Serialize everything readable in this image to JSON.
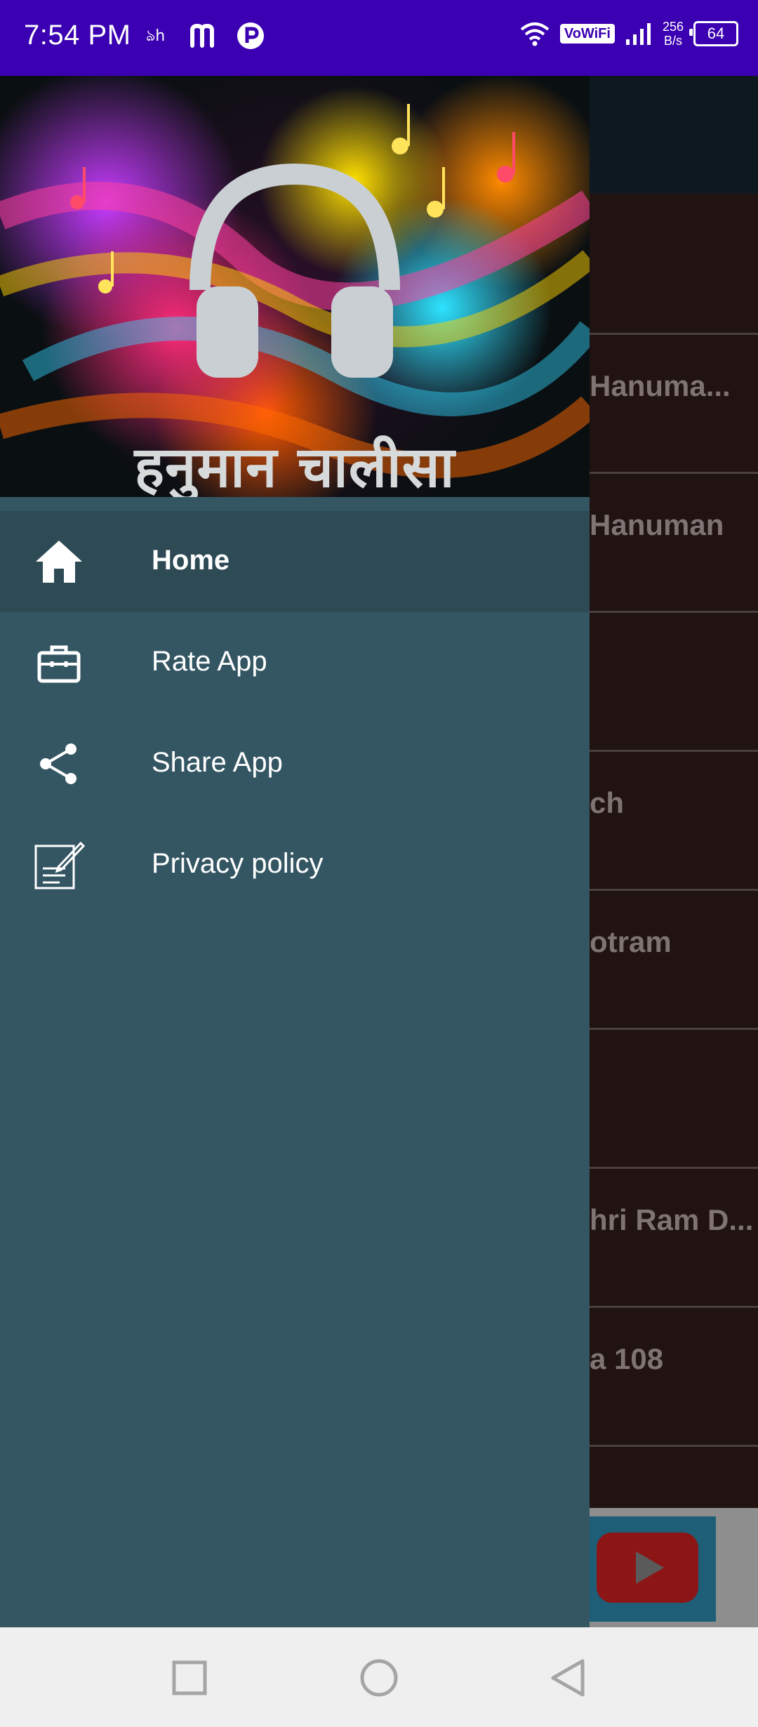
{
  "status_bar": {
    "time": "7:54 PM",
    "network_label": "VoWiFi",
    "speed_value": "256",
    "speed_unit": "B/s",
    "battery": "64",
    "icons": [
      "notification-icon",
      "m-app-icon",
      "p-app-icon",
      "wifi-icon",
      "signal-icon",
      "battery-icon"
    ]
  },
  "drawer": {
    "header_title": "हनुमान चालीसा",
    "header_icon": "headphones-icon",
    "items": [
      {
        "label": "Home",
        "icon": "home-icon",
        "active": true
      },
      {
        "label": "Rate App",
        "icon": "briefcase-icon",
        "active": false
      },
      {
        "label": "Share App",
        "icon": "share-icon",
        "active": false
      },
      {
        "label": "Privacy policy",
        "icon": "edit-note-icon",
        "active": false
      }
    ]
  },
  "background_list": {
    "rows": [
      {
        "text": ""
      },
      {
        "text": " Hanuma..."
      },
      {
        "text": "Hanuman"
      },
      {
        "text": ""
      },
      {
        "text": "ch"
      },
      {
        "text": "otram"
      },
      {
        "text": ""
      },
      {
        "text": "hri Ram D..."
      },
      {
        "text": "a 108"
      }
    ],
    "ad_icon": "youtube-play-icon"
  },
  "nav_bar": {
    "buttons": [
      "recents-square-icon",
      "home-circle-icon",
      "back-triangle-icon"
    ]
  },
  "colors": {
    "status_bar": "#3a00b2",
    "drawer_bg": "#345663",
    "drawer_active": "#2d4a55",
    "nav_bar": "#efefef"
  }
}
